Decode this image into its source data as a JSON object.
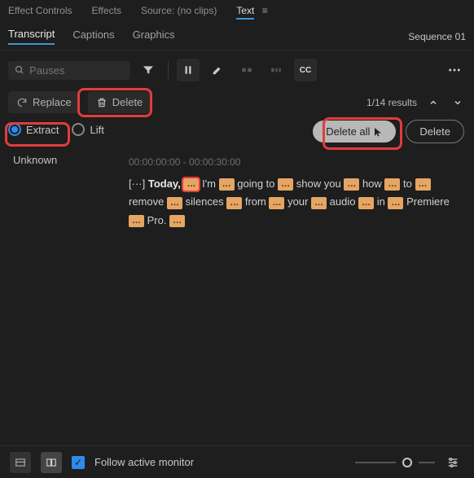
{
  "topTabs": {
    "effectControls": "Effect Controls",
    "effects": "Effects",
    "source": "Source: (no clips)",
    "text": "Text"
  },
  "panelTabs": {
    "transcript": "Transcript",
    "captions": "Captions",
    "graphics": "Graphics",
    "sequence": "Sequence 01"
  },
  "search": {
    "placeholder": "Pauses"
  },
  "actions": {
    "replace": "Replace",
    "delete": "Delete"
  },
  "results": {
    "label": "1/14 results"
  },
  "radios": {
    "extract": "Extract",
    "lift": "Lift"
  },
  "pills": {
    "deleteAll": "Delete all",
    "delete": "Delete"
  },
  "transcript": {
    "speaker": "Unknown",
    "timecode": "00:00:00:00 - 00:00:30:00",
    "lead": "[···]",
    "pauseGlyph": "…",
    "w": {
      "today": "Today,",
      "im": "I'm",
      "goingto": "going to",
      "showyou": "show you",
      "how": "how",
      "to": "to",
      "remove": "remove",
      "silences": "silences",
      "from": "from",
      "your": "your",
      "audio": "audio",
      "in": "in",
      "premiere": "Premiere",
      "pro": "Pro."
    }
  },
  "footer": {
    "follow": "Follow active monitor"
  }
}
